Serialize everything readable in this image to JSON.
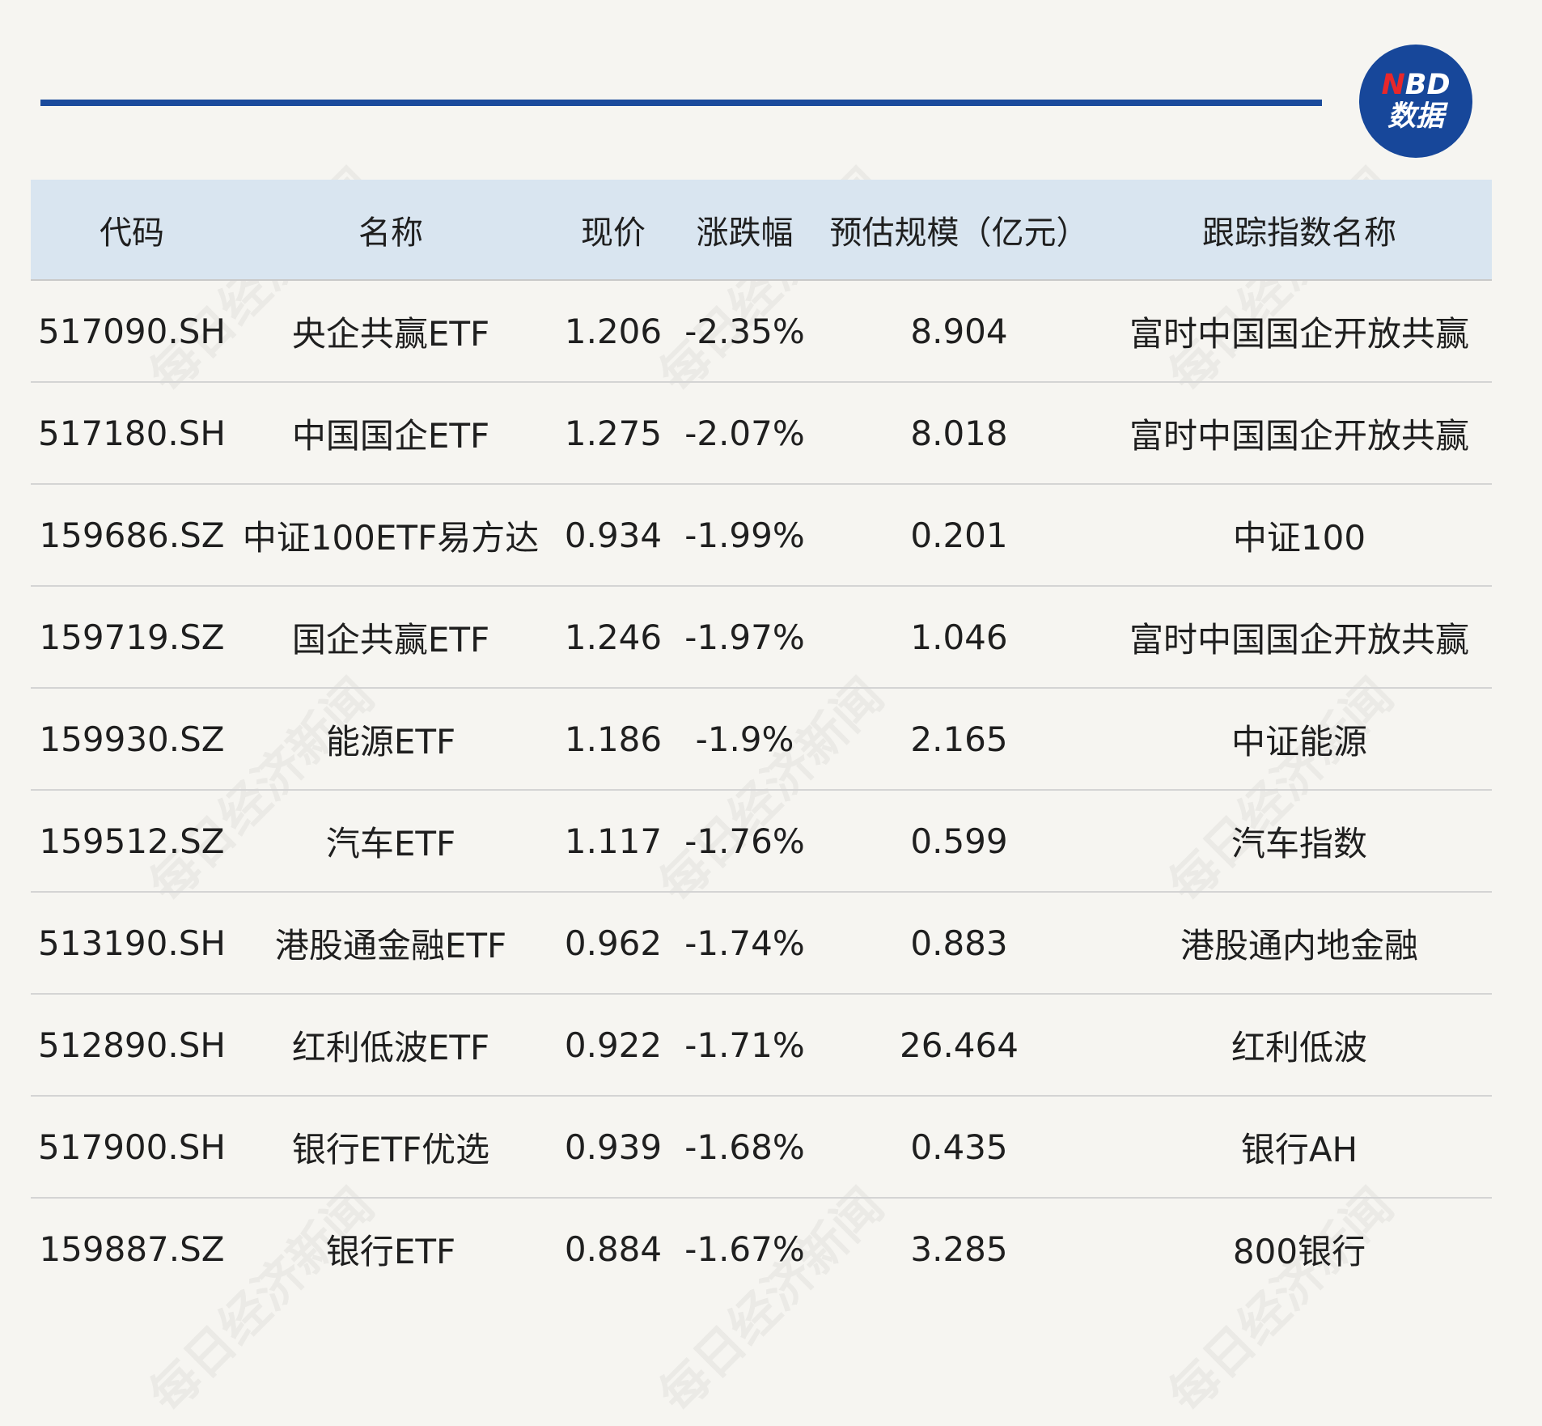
{
  "logo": {
    "line1_n": "N",
    "line1_rest": "BD",
    "line2": "数据"
  },
  "watermark": "每日经济新闻",
  "table": {
    "headers": [
      "代码",
      "名称",
      "现价",
      "涨跌幅",
      "预估规模（亿元）",
      "跟踪指数名称"
    ],
    "rows": [
      [
        "517090.SH",
        "央企共赢ETF",
        "1.206",
        "-2.35%",
        "8.904",
        "富时中国国企开放共赢"
      ],
      [
        "517180.SH",
        "中国国企ETF",
        "1.275",
        "-2.07%",
        "8.018",
        "富时中国国企开放共赢"
      ],
      [
        "159686.SZ",
        "中证100ETF易方达",
        "0.934",
        "-1.99%",
        "0.201",
        "中证100"
      ],
      [
        "159719.SZ",
        "国企共赢ETF",
        "1.246",
        "-1.97%",
        "1.046",
        "富时中国国企开放共赢"
      ],
      [
        "159930.SZ",
        "能源ETF",
        "1.186",
        "-1.9%",
        "2.165",
        "中证能源"
      ],
      [
        "159512.SZ",
        "汽车ETF",
        "1.117",
        "-1.76%",
        "0.599",
        "汽车指数"
      ],
      [
        "513190.SH",
        "港股通金融ETF",
        "0.962",
        "-1.74%",
        "0.883",
        "港股通内地金融"
      ],
      [
        "512890.SH",
        "红利低波ETF",
        "0.922",
        "-1.71%",
        "26.464",
        "红利低波"
      ],
      [
        "517900.SH",
        "银行ETF优选",
        "0.939",
        "-1.68%",
        "0.435",
        "银行AH"
      ],
      [
        "159887.SZ",
        "银行ETF",
        "0.884",
        "-1.67%",
        "3.285",
        "800银行"
      ]
    ]
  }
}
